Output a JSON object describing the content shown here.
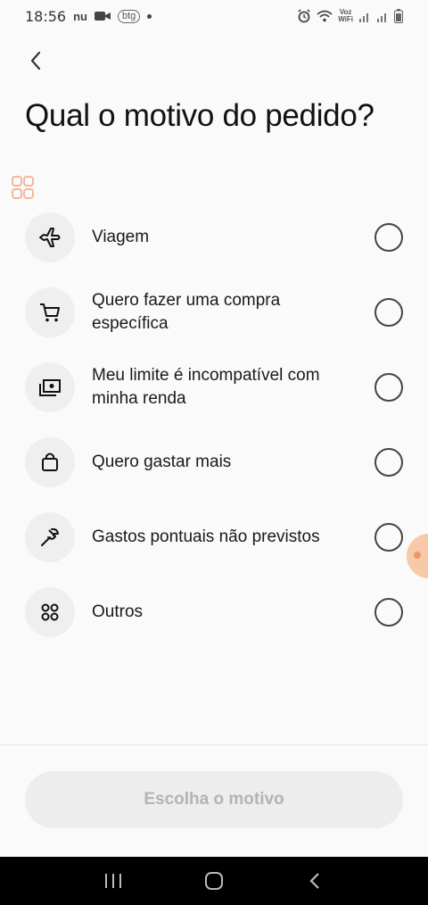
{
  "status_bar": {
    "time": "18:56",
    "nu_label": "nu",
    "btg_label": "btg",
    "voz_top": "Voz",
    "voz_bottom": "WiFi"
  },
  "header": {
    "title": "Qual o motivo do pedido?"
  },
  "options": [
    {
      "label": "Viagem",
      "icon": "airplane-icon"
    },
    {
      "label": "Quero fazer uma compra específica",
      "icon": "cart-icon"
    },
    {
      "label": "Meu limite é incompatível com minha renda",
      "icon": "money-icon"
    },
    {
      "label": "Quero gastar mais",
      "icon": "bag-icon"
    },
    {
      "label": "Gastos pontuais não previstos",
      "icon": "tool-icon"
    },
    {
      "label": "Outros",
      "icon": "grid-icon"
    }
  ],
  "footer": {
    "cta_label": "Escolha o motivo"
  },
  "colors": {
    "background": "#fafafa",
    "icon_circle": "#efefef",
    "button_disabled_bg": "#ededed",
    "button_disabled_text": "#b3b3b3"
  }
}
